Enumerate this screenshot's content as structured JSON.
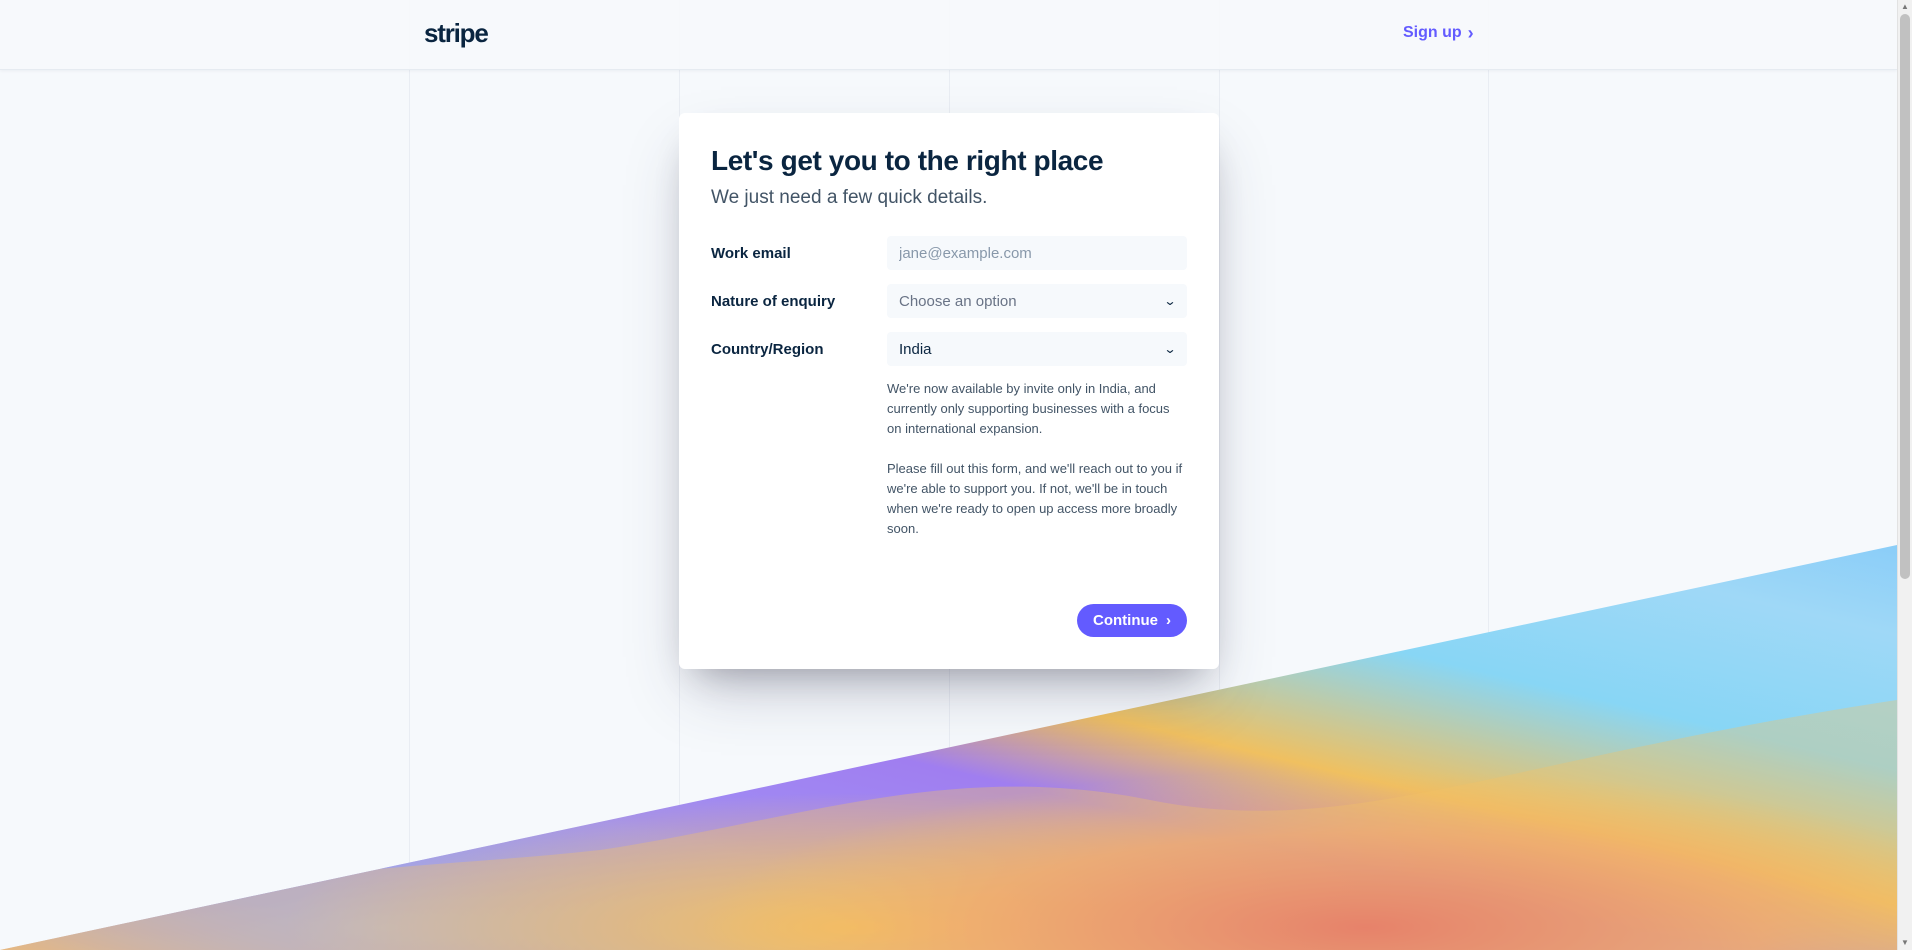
{
  "header": {
    "logo_text": "stripe",
    "signup_label": "Sign up",
    "signup_chevron": "›"
  },
  "card": {
    "title": "Let's get you to the right place",
    "subtitle": "We just need a few quick details.",
    "fields": {
      "email": {
        "label": "Work email",
        "placeholder": "jane@example.com",
        "value": ""
      },
      "enquiry": {
        "label": "Nature of enquiry",
        "selected": "Choose an option",
        "icon": "chevron-down-icon"
      },
      "country": {
        "label": "Country/Region",
        "selected": "India",
        "icon": "chevron-down-icon"
      }
    },
    "info": [
      "We're now available by invite only in India, and currently only supporting businesses with a focus on international expansion.",
      "Please fill out this form, and we'll reach out to you if we're able to support you. If not, we'll be in touch when we're ready to open up access more broadly soon."
    ],
    "continue_label": "Continue",
    "continue_chevron": "›"
  },
  "colors": {
    "brand": "#635bff",
    "text_dark": "#0a2540",
    "text_muted": "#425466",
    "background": "#f6f9fc"
  }
}
